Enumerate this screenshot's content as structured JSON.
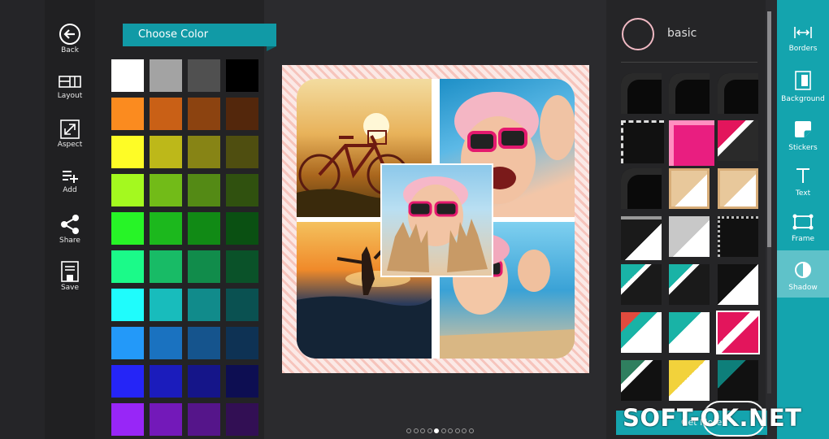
{
  "left_nav": [
    {
      "label": "Back",
      "icon": "back-arrow-icon"
    },
    {
      "label": "Layout",
      "icon": "layout-icon"
    },
    {
      "label": "Aspect",
      "icon": "aspect-icon"
    },
    {
      "label": "Add",
      "icon": "add-icon"
    },
    {
      "label": "Share",
      "icon": "share-icon"
    },
    {
      "label": "Save",
      "icon": "save-icon"
    }
  ],
  "color_panel": {
    "title": "Choose Color",
    "swatches": [
      [
        "#ffffff",
        "#a3a3a3",
        "#505050",
        "#000000"
      ],
      [
        "#fb8b1f",
        "#c96016",
        "#8c4310",
        "#53270c"
      ],
      [
        "#fefc26",
        "#bdb819",
        "#878415",
        "#4f4e10"
      ],
      [
        "#a4f91f",
        "#72bb18",
        "#548a15",
        "#30510f"
      ],
      [
        "#27f427",
        "#1cb81d",
        "#118a15",
        "#0a5012"
      ],
      [
        "#1bfa89",
        "#18bb66",
        "#118c4b",
        "#0a5229"
      ],
      [
        "#1ffcfc",
        "#18bcbc",
        "#118b8b",
        "#0a5151"
      ],
      [
        "#2399f9",
        "#1a72c0",
        "#15548d",
        "#0e3254"
      ],
      [
        "#2525f7",
        "#1b1cbc",
        "#151589",
        "#0d0e52"
      ],
      [
        "#9826f7",
        "#7319b9",
        "#55158a",
        "#320f54"
      ]
    ]
  },
  "page_dots": {
    "count": 10,
    "active": 5
  },
  "right_panel": {
    "style_label": "basic",
    "frames": [
      [
        "black-rounded",
        "black-rounded",
        "black-rounded"
      ],
      [
        "black-stitched",
        "pink-lace",
        "pink-stripe"
      ],
      [
        "black-rounded",
        "beige-wood",
        "beige-wood"
      ],
      [
        "black-metal",
        "silver-metal",
        "black-dotted"
      ],
      [
        "teal-stripe",
        "teal-stripe",
        "black-square"
      ],
      [
        "teal-red-stripe",
        "teal-white-stripe",
        "pink-white-selected"
      ],
      [
        "green-stripe",
        "yellow-stripe",
        "teal-dark-stripe"
      ]
    ],
    "get_more_label": "Get More!"
  },
  "right_bar": [
    {
      "label": "Borders",
      "icon": "borders-icon"
    },
    {
      "label": "Background",
      "icon": "background-icon"
    },
    {
      "label": "Stickers",
      "icon": "stickers-icon"
    },
    {
      "label": "Text",
      "icon": "text-icon"
    },
    {
      "label": "Frame",
      "icon": "frame-icon"
    },
    {
      "label": "Shadow",
      "icon": "shadow-icon",
      "active": true
    }
  ],
  "watermark": "SOFT-OK.NET",
  "colors": {
    "accent": "#14a4ae",
    "header_bg": "#119aa6",
    "border_pink": "#f6c4bc"
  }
}
